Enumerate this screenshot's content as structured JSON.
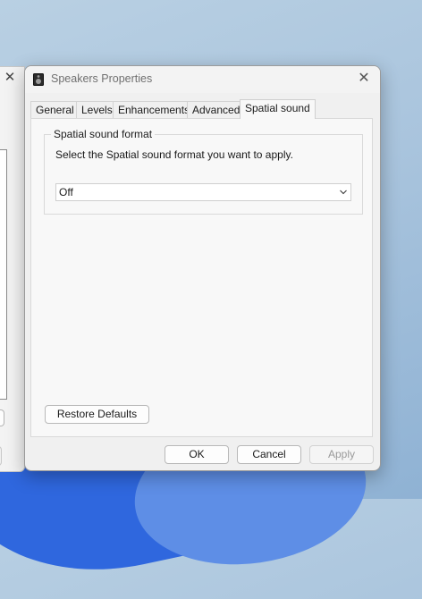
{
  "dialog": {
    "title": "Speakers Properties",
    "tabs": [
      {
        "label": "General"
      },
      {
        "label": "Levels"
      },
      {
        "label": "Enhancements"
      },
      {
        "label": "Advanced"
      },
      {
        "label": "Spatial sound"
      }
    ],
    "active_tab": "Spatial sound",
    "group": {
      "label": "Spatial sound format",
      "description": "Select the Spatial sound format you want to apply.",
      "format_select": {
        "value": "Off"
      }
    },
    "restore_defaults_label": "Restore Defaults",
    "buttons": {
      "ok": "OK",
      "cancel": "Cancel",
      "apply": "Apply"
    }
  },
  "icons": {
    "speaker": "speaker-icon",
    "close": "close-icon",
    "chevron": "chevron-down-icon"
  },
  "colors": {
    "dialog_bg": "#f0f0f0",
    "panel_bg": "#f8f8f8",
    "disabled_text": "#9a9a9a"
  }
}
